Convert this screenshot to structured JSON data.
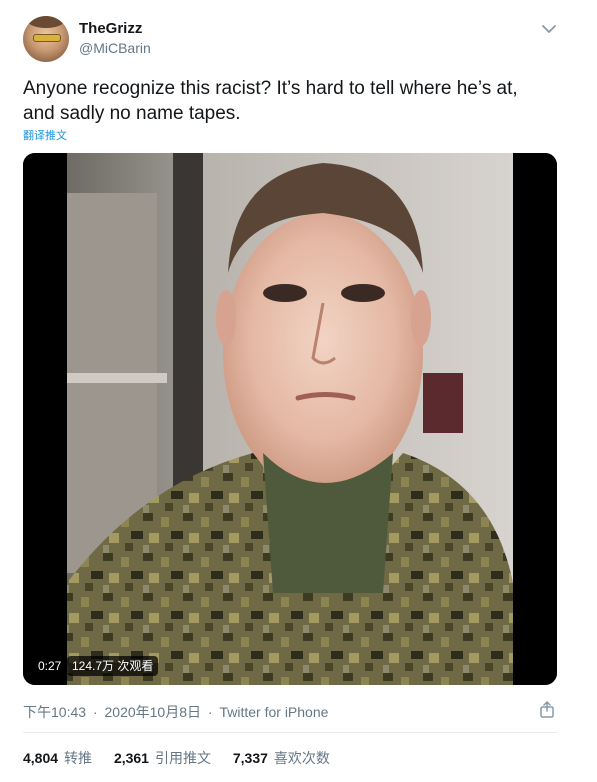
{
  "user": {
    "display_name": "TheGrizz",
    "handle": "@MiCBarin"
  },
  "tweet": {
    "text_line1": "Anyone recognize this racist? It’s hard to tell where he’s at,",
    "text_line2": "and sadly no name tapes.",
    "translate_label": "翻译推文"
  },
  "video": {
    "duration": "0:27",
    "views": "124.7万 次观看"
  },
  "meta": {
    "time": "下午10:43",
    "separator": "·",
    "date": "2020年10月8日",
    "source": "Twitter for iPhone"
  },
  "stats": [
    {
      "count": "4,804",
      "label": "转推"
    },
    {
      "count": "2,361",
      "label": "引用推文"
    },
    {
      "count": "7,337",
      "label": "喜欢次数"
    }
  ],
  "icons": {
    "caret": "chevron-down-icon",
    "share": "share-icon"
  },
  "colors": {
    "link": "#1b95e0",
    "secondary_text": "#657786",
    "primary_text": "#14171a"
  }
}
